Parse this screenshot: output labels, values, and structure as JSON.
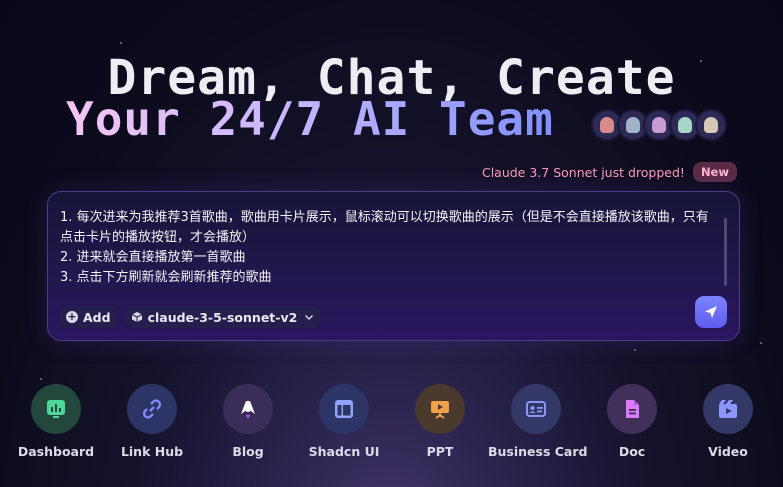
{
  "hero": {
    "title": "Dream, Chat, Create",
    "subtitle": "Your 24/7 AI Team"
  },
  "avatars": [
    {
      "icon": "mascot-avatar-1",
      "color": "#d98a8a"
    },
    {
      "icon": "mascot-avatar-2",
      "color": "#9fb3c8"
    },
    {
      "icon": "mascot-avatar-3",
      "color": "#c89ad6"
    },
    {
      "icon": "mascot-avatar-4",
      "color": "#a6d6c8"
    },
    {
      "icon": "mascot-avatar-5",
      "color": "#d6c7b6"
    }
  ],
  "announcement": {
    "text": "Claude 3.7 Sonnet just dropped!",
    "badge": "New"
  },
  "chat": {
    "prompt": "1. 每次进来为我推荐3首歌曲，歌曲用卡片展示，鼠标滚动可以切换歌曲的展示（但是不会直接播放该歌曲，只有点击卡片的播放按钮，才会播放）\n2. 进来就会直接播放第一首歌曲\n3. 点击下方刷新就会刷新推荐的歌曲",
    "add_label": "Add",
    "model_label": "claude-3-5-sonnet-v2",
    "send_icon": "send-icon"
  },
  "apps": [
    {
      "label": "Dashboard",
      "icon": "dashboard-icon",
      "bg": "#23473d",
      "fg": "#4fd69a"
    },
    {
      "label": "Link Hub",
      "icon": "link-icon",
      "bg": "#2c3566",
      "fg": "#7f8cff"
    },
    {
      "label": "Blog",
      "icon": "blog-icon",
      "bg": "#3a2d5a",
      "fg": "#ffffff"
    },
    {
      "label": "Shadcn UI",
      "icon": "layout-icon",
      "bg": "#2c3566",
      "fg": "#8fa3ff"
    },
    {
      "label": "PPT",
      "icon": "presentation-icon",
      "bg": "#4a3a2e",
      "fg": "#f0a24a"
    },
    {
      "label": "Business Card",
      "icon": "id-card-icon",
      "bg": "#343866",
      "fg": "#8c96ff"
    },
    {
      "label": "Doc",
      "icon": "document-icon",
      "bg": "#40305a",
      "fg": "#d97aff"
    },
    {
      "label": "Video",
      "icon": "video-icon",
      "bg": "#343866",
      "fg": "#8c96ff"
    }
  ]
}
